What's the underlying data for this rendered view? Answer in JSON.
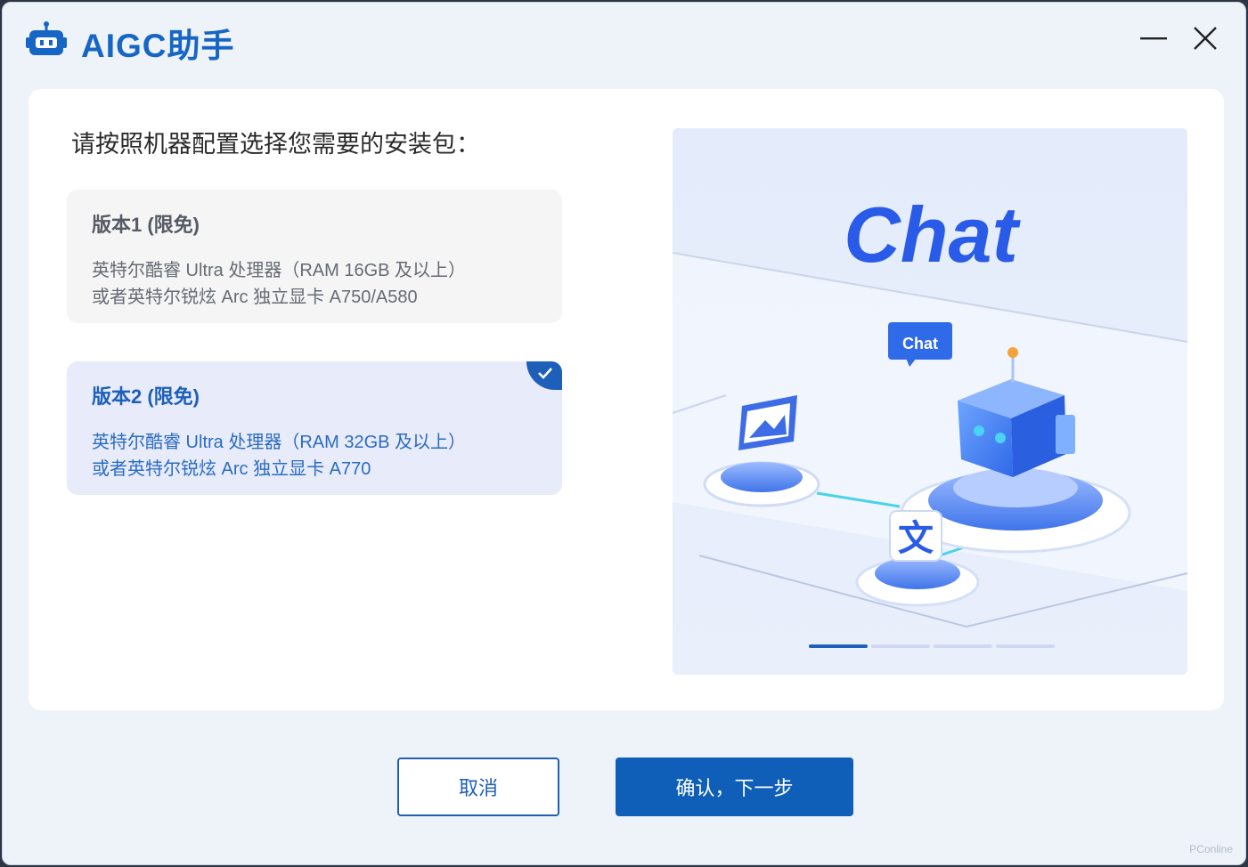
{
  "app": {
    "title": "AIGC助手"
  },
  "window_controls": {
    "minimize": "minimize",
    "close": "close"
  },
  "prompt": "请按照机器配置选择您需要的安装包：",
  "options": [
    {
      "title": "版本1 (限免)",
      "line1": "英特尔酷睿 Ultra 处理器（RAM 16GB 及以上）",
      "line2": "或者英特尔锐炫 Arc 独立显卡 A750/A580",
      "selected": false
    },
    {
      "title": "版本2 (限免)",
      "line1": "英特尔酷睿 Ultra 处理器（RAM 32GB 及以上）",
      "line2": "或者英特尔锐炫 Arc 独立显卡 A770",
      "selected": true
    }
  ],
  "illustration": {
    "headline": "Chat",
    "bubble": "Chat",
    "char_icon": "文",
    "slides_total": 4,
    "slide_active": 1
  },
  "buttons": {
    "cancel": "取消",
    "next": "确认，下一步"
  },
  "watermark": "PConline",
  "colors": {
    "accent": "#1d5fb9",
    "window_bg": "#eef3fa",
    "selected_bg": "#e8ecfa"
  }
}
